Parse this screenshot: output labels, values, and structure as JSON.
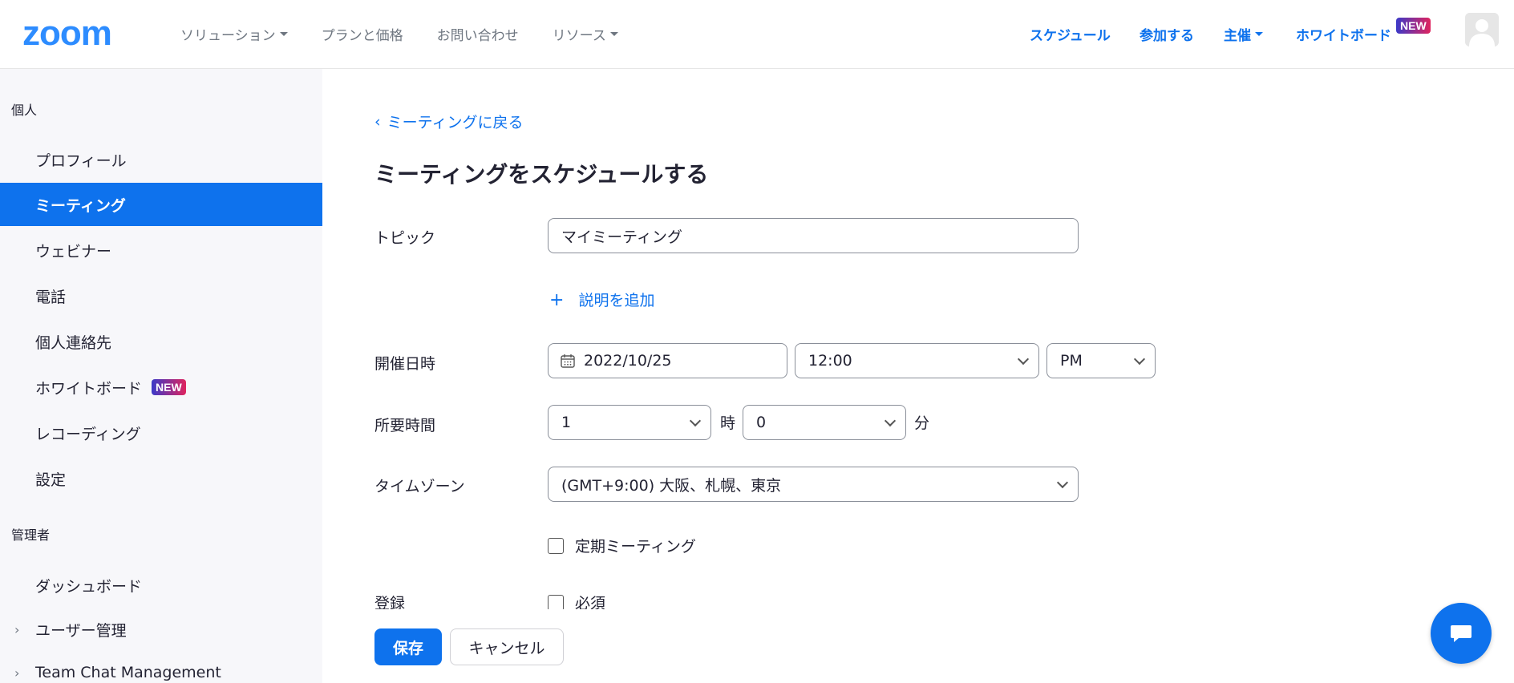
{
  "brand": {
    "logo": "zoom",
    "accent": "#0e72ed",
    "logo_color": "#2d8cff"
  },
  "header": {
    "nav_left": [
      {
        "label": "ソリューション"
      },
      {
        "label": "プランと価格"
      },
      {
        "label": "お問い合わせ"
      },
      {
        "label": "リソース"
      }
    ],
    "nav_right": {
      "schedule": "スケジュール",
      "join": "参加する",
      "host": "主催",
      "whiteboard": "ホワイトボード",
      "new_badge": "NEW"
    }
  },
  "sidebar": {
    "personal_heading": "個人",
    "personal_items": [
      {
        "label": "プロフィール"
      },
      {
        "label": "ミーティング"
      },
      {
        "label": "ウェビナー"
      },
      {
        "label": "電話"
      },
      {
        "label": "個人連絡先"
      },
      {
        "label": "ホワイトボード",
        "badge": "NEW"
      },
      {
        "label": "レコーディング"
      },
      {
        "label": "設定"
      }
    ],
    "admin_heading": "管理者",
    "admin_items": [
      {
        "label": "ダッシュボード"
      },
      {
        "label": "ユーザー管理"
      },
      {
        "label": "Team Chat Management"
      }
    ]
  },
  "main": {
    "back_link": "ミーティングに戻る",
    "title": "ミーティングをスケジュールする",
    "topic_label": "トピック",
    "topic_value": "マイミーティング",
    "add_description": "説明を追加",
    "datetime_label": "開催日時",
    "date_value": "2022/10/25",
    "time_value": "12:00",
    "ampm_value": "PM",
    "duration_label": "所要時間",
    "duration_hours": "1",
    "hours_unit": "時",
    "duration_minutes": "0",
    "minutes_unit": "分",
    "timezone_label": "タイムゾーン",
    "timezone_value": "(GMT+9:00) 大阪、札幌、東京",
    "recurring_label": "定期ミーティング",
    "registration_label": "登録",
    "registration_required": "必須"
  },
  "footer": {
    "save": "保存",
    "cancel": "キャンセル"
  }
}
